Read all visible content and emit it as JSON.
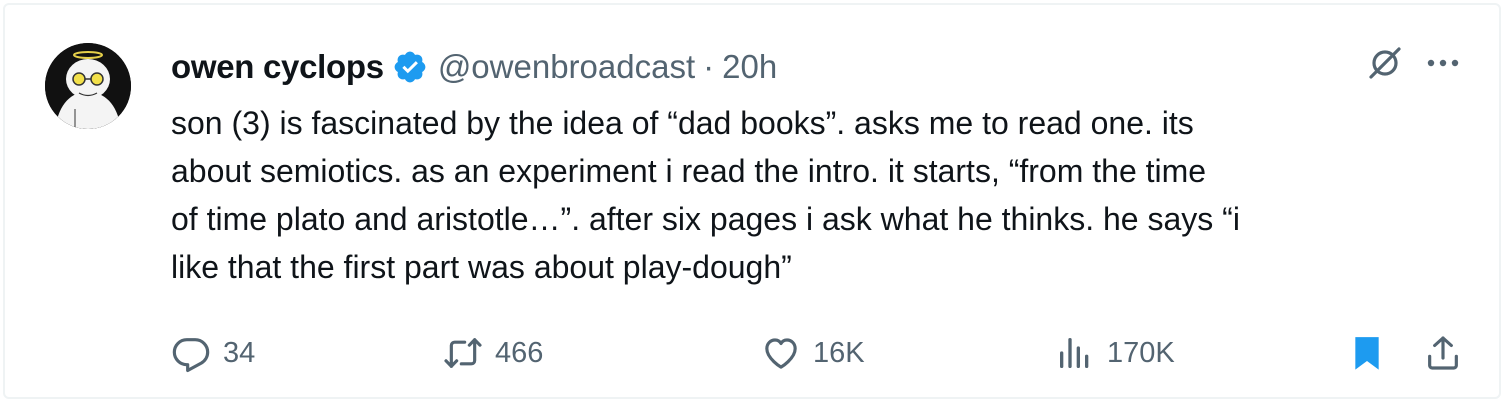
{
  "author": {
    "name": "owen cyclops",
    "handle": "@owenbroadcast",
    "separator": "·",
    "time": "20h",
    "verified": true
  },
  "tweet": {
    "lines": [
      "son (3) is fascinated by the idea of “dad books”. asks me to read one. its",
      "about semiotics. as an experiment i read the intro. it starts, “from the time",
      "of time plato and aristotle…”. after six pages i ask what he thinks. he says “i",
      "like that the first part was about play-dough”"
    ]
  },
  "actions": {
    "replies": "34",
    "retweets": "466",
    "likes": "16K",
    "views": "170K"
  },
  "colors": {
    "text": "#0f1419",
    "muted": "#536471",
    "accent": "#1d9bf0"
  },
  "icons": [
    "avatar",
    "verified-badge-icon",
    "grok-icon",
    "more-icon",
    "reply-icon",
    "retweet-icon",
    "like-icon",
    "views-icon",
    "bookmark-icon",
    "share-icon"
  ]
}
